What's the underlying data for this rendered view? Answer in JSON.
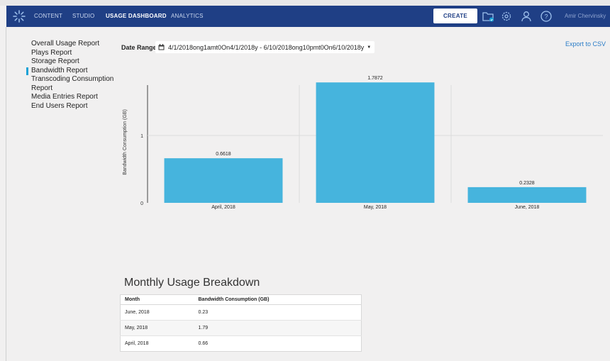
{
  "nav": {
    "items": [
      {
        "label": "CONTENT",
        "active": false
      },
      {
        "label": "STUDIO",
        "active": false
      },
      {
        "label": "USAGE DASHBOARD",
        "active": true
      },
      {
        "label": "ANALYTICS",
        "active": false
      }
    ],
    "create_label": "CREATE",
    "icons": [
      "logo-icon",
      "folder-upload-icon",
      "gear-icon",
      "user-icon",
      "help-icon"
    ],
    "user_name": "Amir Chervinsky",
    "colors": {
      "bar": "#1f3f85",
      "accent": "#1aa2d6"
    }
  },
  "sidebar": {
    "items": [
      {
        "label": "Overall Usage Report",
        "active": false
      },
      {
        "label": "Plays Report",
        "active": false
      },
      {
        "label": "Storage Report",
        "active": false
      },
      {
        "label": "Bandwidth Report",
        "active": true
      },
      {
        "label": "Transcoding Consumption Report",
        "active": false
      },
      {
        "label": "Media Entries Report",
        "active": false
      },
      {
        "label": "End Users Report",
        "active": false
      }
    ]
  },
  "filters": {
    "date_range_label": "Date Range",
    "date_range_value": "4/1/2018ong1amt0On4/1/2018y - 6/10/2018ong10pmt0On6/10/2018y",
    "export_label": "Export to CSV"
  },
  "chart_data": {
    "type": "bar",
    "categories": [
      "April, 2018",
      "May, 2018",
      "June, 2018"
    ],
    "values": [
      0.6618,
      1.7872,
      0.2328
    ],
    "value_labels": [
      "0.6618",
      "1.7872",
      "0.2328"
    ],
    "ylabel": "Bandwidth Consumption (GB)",
    "yticks": [
      0,
      1
    ],
    "ylim": [
      0,
      1.8
    ],
    "grid": true,
    "bar_color": "#46b4dd"
  },
  "breakdown": {
    "title": "Monthly Usage Breakdown",
    "columns": [
      "Month",
      "Bandwidth Consumption (GB)"
    ],
    "rows": [
      [
        "June, 2018",
        "0.23"
      ],
      [
        "May, 2018",
        "1.79"
      ],
      [
        "April, 2018",
        "0.66"
      ]
    ]
  }
}
